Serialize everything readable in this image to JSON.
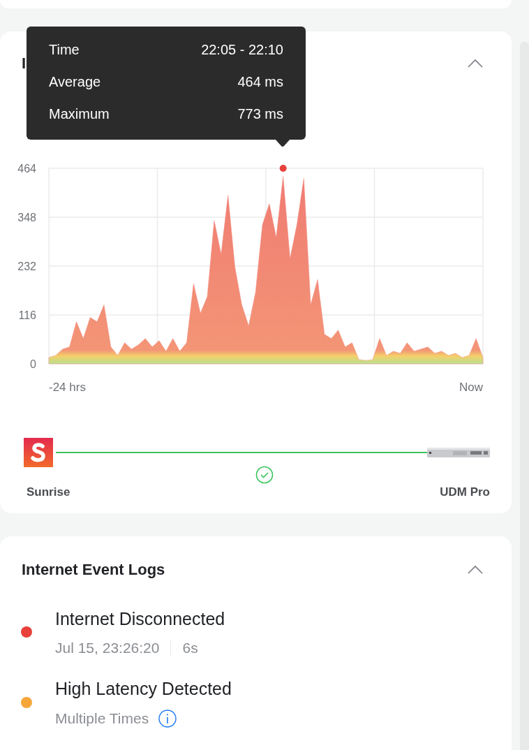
{
  "latency_card": {
    "title": "I",
    "expanded": true,
    "chart_data": {
      "type": "area",
      "grid": true,
      "ylim": [
        0,
        464
      ],
      "yticks": [
        0,
        116,
        232,
        348,
        464
      ],
      "series": [
        {
          "color": "#f28a80",
          "values": [
            15,
            20,
            35,
            40,
            100,
            60,
            110,
            100,
            140,
            40,
            20,
            50,
            35,
            45,
            60,
            40,
            55,
            30,
            60,
            30,
            50,
            190,
            120,
            160,
            340,
            260,
            400,
            230,
            140,
            90,
            170,
            330,
            380,
            300,
            445,
            250,
            330,
            440,
            140,
            200,
            70,
            60,
            80,
            40,
            50,
            10,
            8,
            10,
            60,
            20,
            30,
            25,
            50,
            30,
            35,
            40,
            25,
            30,
            20,
            25,
            15,
            20,
            60,
            15
          ]
        }
      ]
    },
    "x_axis_labels": [
      "-24 hrs",
      "Now"
    ],
    "tooltip": [
      {
        "label": "Time",
        "value": "22:05 - 22:10"
      },
      {
        "label": "Average",
        "value": "464 ms"
      },
      {
        "label": "Maximum",
        "value": "773 ms"
      }
    ],
    "connection": {
      "from": "Sunrise",
      "to": "UDM Pro",
      "healthy": true
    }
  },
  "event_logs": {
    "title": "Internet Event Logs",
    "expanded": true,
    "events": [
      {
        "title": "Internet Disconnected",
        "color": "#e8403a",
        "kind": "timed",
        "time": "Jul 15, 23:26:20",
        "duration": "6s"
      },
      {
        "title": "High Latency Detected",
        "color": "#f4a63a",
        "kind": "repeated",
        "detail": "Multiple Times"
      }
    ]
  }
}
